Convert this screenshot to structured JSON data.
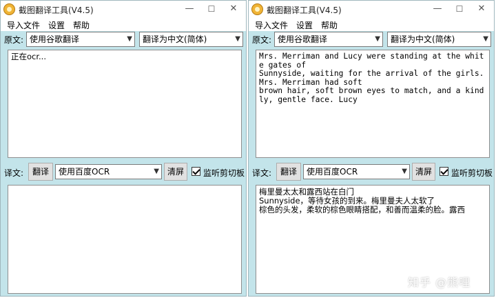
{
  "app": {
    "title": "截图翻译工具(V4.5)"
  },
  "menu": [
    "导入文件",
    "设置",
    "帮助"
  ],
  "source": {
    "label": "原文:",
    "engine": "使用谷歌翻译",
    "target_lang": "翻译为中文(简体)"
  },
  "translate": {
    "label": "译文:",
    "button": "翻译",
    "ocr_engine": "使用百度OCR",
    "clear": "清屏",
    "monitor_label": "监听剪切板"
  },
  "left_window": {
    "source_text": "正在ocr...",
    "target_text": ""
  },
  "right_window": {
    "source_text": "Mrs. Merriman and Lucy were standing at the white gates of\nSunnyside, waiting for the arrival of the girls. Mrs. Merriman had soft\nbrown hair, soft brown eyes to match, and a kindly, gentle face. Lucy",
    "target_text": "梅里曼太太和露西站在白门\nSunnyside，等待女孩的到来。梅里曼夫人太软了\n棕色的头发，柔软的棕色眼睛搭配，和善而温柔的脸。露西"
  },
  "watermark": "知乎 @熊哩"
}
